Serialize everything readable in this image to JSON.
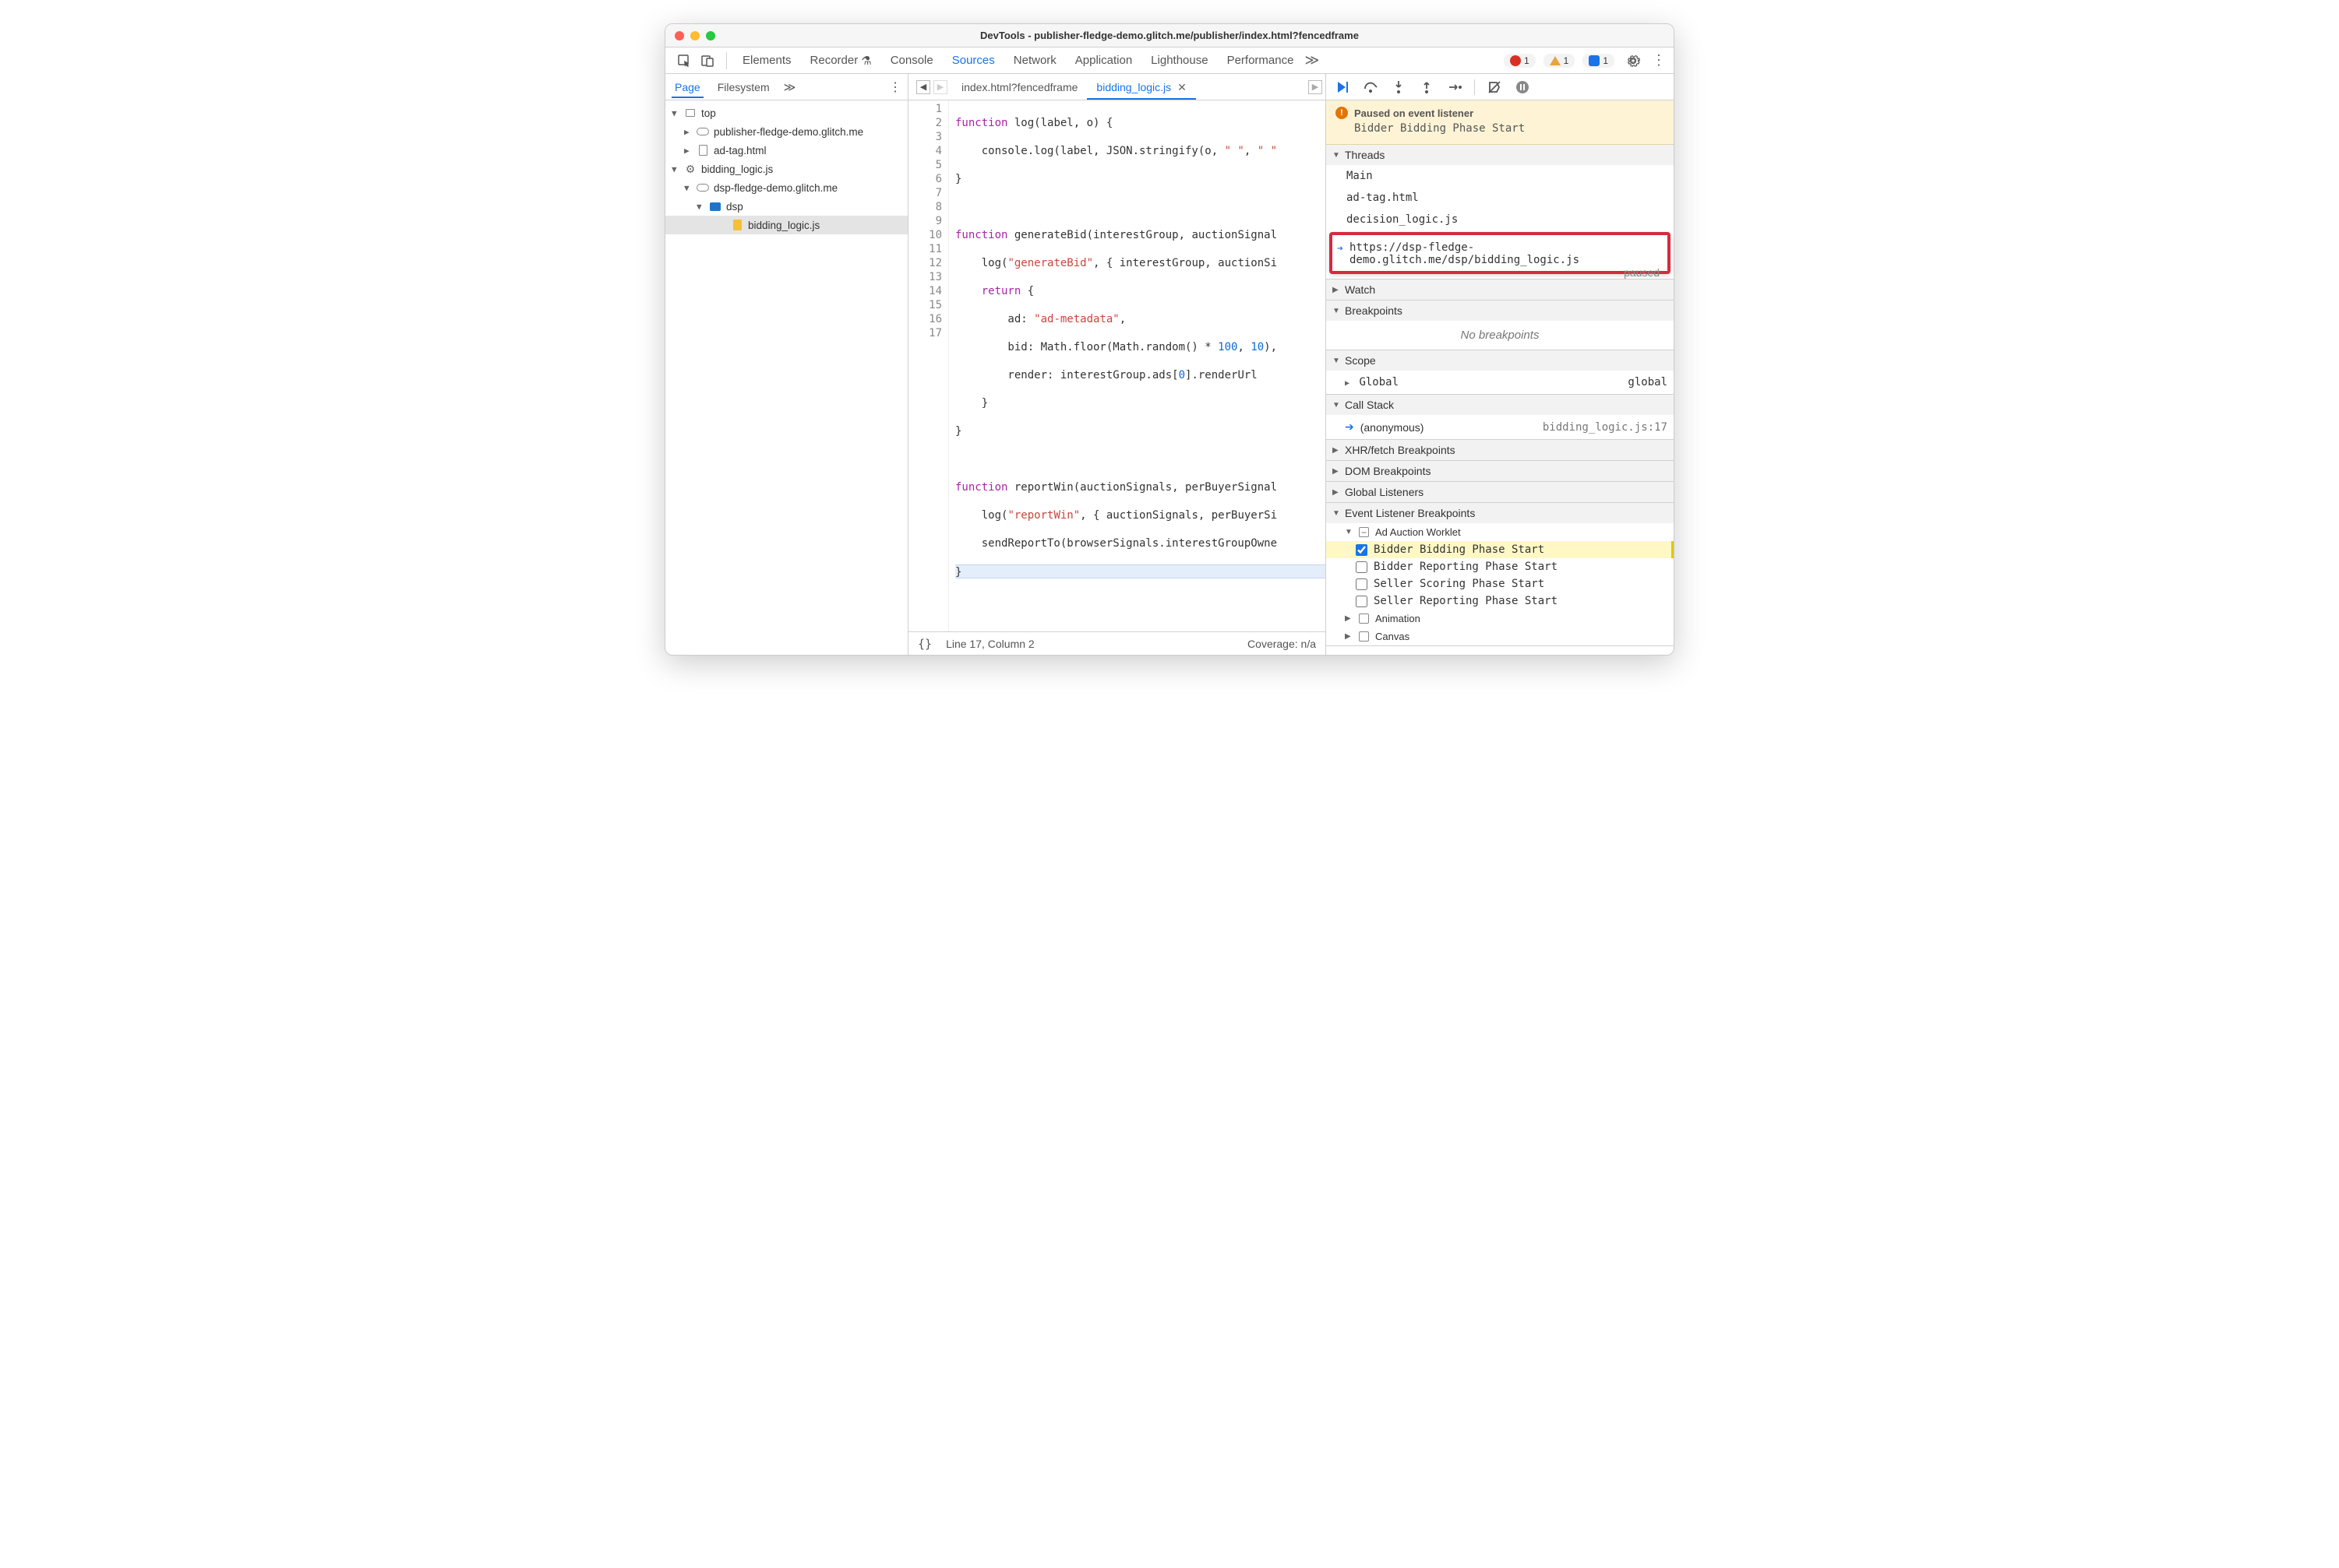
{
  "window": {
    "title": "DevTools - publisher-fledge-demo.glitch.me/publisher/index.html?fencedframe"
  },
  "toolbar": {
    "tabs": [
      "Elements",
      "Recorder",
      "Console",
      "Sources",
      "Network",
      "Application",
      "Lighthouse",
      "Performance"
    ],
    "active_tab": "Sources",
    "errors": "1",
    "warnings": "1",
    "issues": "1"
  },
  "sidebar": {
    "subtabs": [
      "Page",
      "Filesystem"
    ],
    "active_subtab": "Page",
    "tree": {
      "top": "top",
      "pub_domain": "publisher-fledge-demo.glitch.me",
      "ad_tag": "ad-tag.html",
      "bidding_logic_root": "bidding_logic.js",
      "dsp_domain": "dsp-fledge-demo.glitch.me",
      "dsp_folder": "dsp",
      "bidding_logic_file": "bidding_logic.js"
    }
  },
  "editor": {
    "tab1": "index.html?fencedframe",
    "tab2": "bidding_logic.js",
    "lines": [
      "function log(label, o) {",
      "    console.log(label, JSON.stringify(o, \" \", \" \"",
      "}",
      "",
      "function generateBid(interestGroup, auctionSignal",
      "    log(\"generateBid\", { interestGroup, auctionSi",
      "    return {",
      "        ad: \"ad-metadata\",",
      "        bid: Math.floor(Math.random() * 100, 10),",
      "        render: interestGroup.ads[0].renderUrl",
      "    }",
      "}",
      "",
      "function reportWin(auctionSignals, perBuyerSignal",
      "    log(\"reportWin\", { auctionSignals, perBuyerSi",
      "    sendReportTo(browserSignals.interestGroupOwne",
      "}"
    ],
    "status_line": "Line 17, Column 2",
    "status_coverage": "Coverage: n/a"
  },
  "debug": {
    "paused_title": "Paused on event listener",
    "paused_detail": "Bidder Bidding Phase Start",
    "sect_threads": "Threads",
    "threads": {
      "main": "Main",
      "adtag": "ad-tag.html",
      "decision": "decision_logic.js",
      "paused_url": "https://dsp-fledge-demo.glitch.me/dsp/bidding_logic.js",
      "paused_label": "paused"
    },
    "sect_watch": "Watch",
    "sect_bp": "Breakpoints",
    "no_bp": "No breakpoints",
    "sect_scope": "Scope",
    "scope_global": "Global",
    "scope_global_val": "global",
    "sect_callstack": "Call Stack",
    "cs_anon": "(anonymous)",
    "cs_loc": "bidding_logic.js:17",
    "sect_xhr": "XHR/fetch Breakpoints",
    "sect_dom": "DOM Breakpoints",
    "sect_gl": "Global Listeners",
    "sect_elb": "Event Listener Breakpoints",
    "elb_cat": "Ad Auction Worklet",
    "elb_items": {
      "bbps": "Bidder Bidding Phase Start",
      "brps": "Bidder Reporting Phase Start",
      "ssps": "Seller Scoring Phase Start",
      "srps": "Seller Reporting Phase Start"
    },
    "elb_anim": "Animation",
    "elb_canvas": "Canvas"
  }
}
